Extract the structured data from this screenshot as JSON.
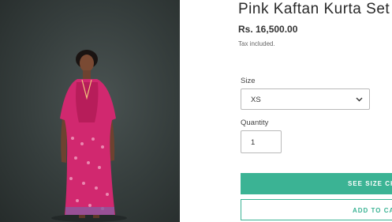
{
  "product": {
    "title": "Pink Kaftan Kurta Set",
    "price": "Rs. 16,500.00",
    "tax_note": "Tax included."
  },
  "options": {
    "size_label": "Size",
    "size_value": "XS",
    "quantity_label": "Quantity",
    "quantity_value": "1"
  },
  "actions": {
    "size_chart": "SEE SIZE CHA",
    "add_to_cart": "ADD TO CART"
  },
  "colors": {
    "accent": "#3bb394",
    "garment": "#d1286f"
  },
  "icons": {
    "size_dropdown": "chevron-down-icon"
  }
}
